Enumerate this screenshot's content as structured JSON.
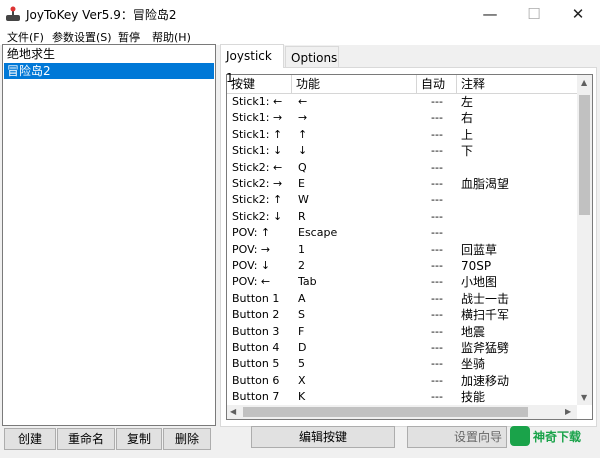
{
  "window": {
    "title": "JoyToKey Ver5.9：冒险岛2",
    "minimize_glyph": "—",
    "maximize_glyph": "☐",
    "close_glyph": "✕"
  },
  "menu": [
    "文件(F)",
    "参数设置(S)",
    "暂停",
    "帮助(H)"
  ],
  "profiles": [
    "绝地求生",
    "冒险岛2"
  ],
  "selected_profile": "冒险岛2",
  "buttons": {
    "create": "创建",
    "rename": "重命名",
    "copy": "复制",
    "delete": "删除",
    "edit": "编辑按键",
    "setup_wizard": "设置向导"
  },
  "tabs": [
    "Joystick 1",
    "Options"
  ],
  "active_tab": "Joystick 1",
  "table": {
    "headers": [
      "按键",
      "功能",
      "自动",
      "注释"
    ],
    "rows": [
      {
        "key": "Stick1: ←",
        "func": "←",
        "auto": "---",
        "note": "左"
      },
      {
        "key": "Stick1: →",
        "func": "→",
        "auto": "---",
        "note": "右"
      },
      {
        "key": "Stick1: ↑",
        "func": "↑",
        "auto": "---",
        "note": "上"
      },
      {
        "key": "Stick1: ↓",
        "func": "↓",
        "auto": "---",
        "note": "下"
      },
      {
        "key": "Stick2: ←",
        "func": "Q",
        "auto": "---",
        "note": ""
      },
      {
        "key": "Stick2: →",
        "func": "E",
        "auto": "---",
        "note": "血脂渴望"
      },
      {
        "key": "Stick2: ↑",
        "func": "W",
        "auto": "---",
        "note": ""
      },
      {
        "key": "Stick2: ↓",
        "func": "R",
        "auto": "---",
        "note": ""
      },
      {
        "key": "POV: ↑",
        "func": "Escape",
        "auto": "---",
        "note": ""
      },
      {
        "key": "POV: →",
        "func": "1",
        "auto": "---",
        "note": "回蓝草"
      },
      {
        "key": "POV: ↓",
        "func": "2",
        "auto": "---",
        "note": "70SP"
      },
      {
        "key": "POV: ←",
        "func": "Tab",
        "auto": "---",
        "note": "小地图"
      },
      {
        "key": "Button 1",
        "func": "A",
        "auto": "---",
        "note": "战士一击"
      },
      {
        "key": "Button 2",
        "func": "S",
        "auto": "---",
        "note": "横扫千军"
      },
      {
        "key": "Button 3",
        "func": "F",
        "auto": "---",
        "note": "地震"
      },
      {
        "key": "Button 4",
        "func": "D",
        "auto": "---",
        "note": "监斧猛劈"
      },
      {
        "key": "Button 5",
        "func": "5",
        "auto": "---",
        "note": "坐骑"
      },
      {
        "key": "Button 6",
        "func": "X",
        "auto": "---",
        "note": "加速移动"
      },
      {
        "key": "Button 7",
        "func": "K",
        "auto": "---",
        "note": "技能"
      }
    ]
  },
  "watermark": {
    "text": "神奇下载"
  },
  "colors": {
    "selection": "#0078d7",
    "watermark": "#1aa34a"
  }
}
